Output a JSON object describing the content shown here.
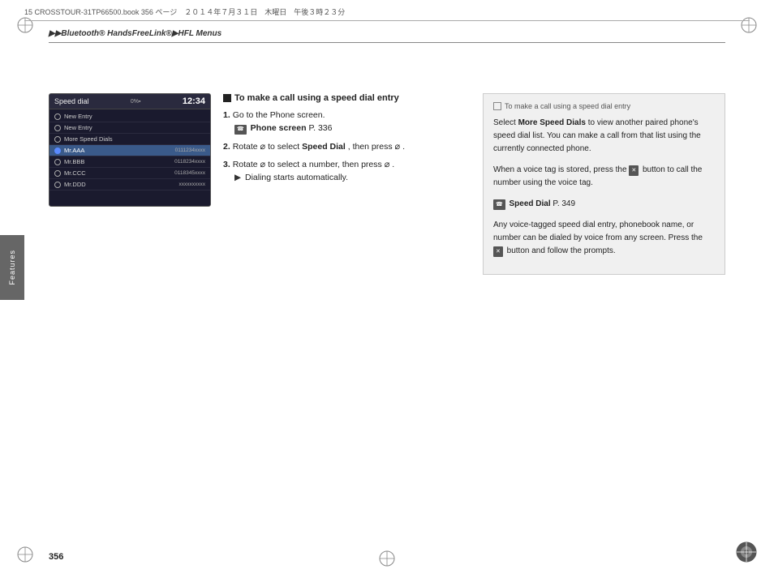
{
  "top_bar": {
    "left_text": "15 CROSSTOUR-31TP66500.book  356 ページ　２０１４年７月３１日　木曜日　午後３時２３分"
  },
  "breadcrumb": {
    "text": "▶▶Bluetooth® HandsFreeLink®▶HFL Menus"
  },
  "features_tab": {
    "label": "Features"
  },
  "screen": {
    "title": "Speed dial",
    "signal": "0%▪",
    "time": "12:34",
    "rows": [
      {
        "label": "New Entry",
        "highlighted": false,
        "phone": ""
      },
      {
        "label": "New Entry",
        "highlighted": false,
        "phone": ""
      },
      {
        "label": "More Speed Dials",
        "highlighted": false,
        "phone": ""
      },
      {
        "label": "Mr.AAA",
        "highlighted": true,
        "phone": "0111234xxxx"
      },
      {
        "label": "Mr.BBB",
        "highlighted": false,
        "phone": "0118234xxxx"
      },
      {
        "label": "Mr.CCC",
        "highlighted": false,
        "phone": "0118345xxxx"
      },
      {
        "label": "Mr.DDD",
        "highlighted": false,
        "phone": "xxxxxxxxxx"
      }
    ]
  },
  "instructions": {
    "section_title": "To make a call using a speed dial entry",
    "steps": [
      {
        "num": "1.",
        "text": "Go to the Phone screen.",
        "sub": "☎ Phone screen P. 336"
      },
      {
        "num": "2.",
        "text": "Rotate ⌀ to select Speed Dial, then press ⌀."
      },
      {
        "num": "3.",
        "text": "Rotate ⌀ to select a number, then press ⌀.",
        "sub": "▶ Dialing starts automatically."
      }
    ]
  },
  "info_panel": {
    "header": "To make a call using a speed dial entry",
    "paragraphs": [
      "Select More Speed Dials to view another paired phone's speed dial list. You can make a call from that list using the currently connected phone.",
      "When a voice tag is stored, press the [✕] button to call the number using the voice tag.",
      "Speed Dial P. 349",
      "Any voice-tagged speed dial entry, phonebook name, or number can be dialed by voice from any screen. Press the [✕] button and follow the prompts."
    ]
  },
  "page_number": "356"
}
